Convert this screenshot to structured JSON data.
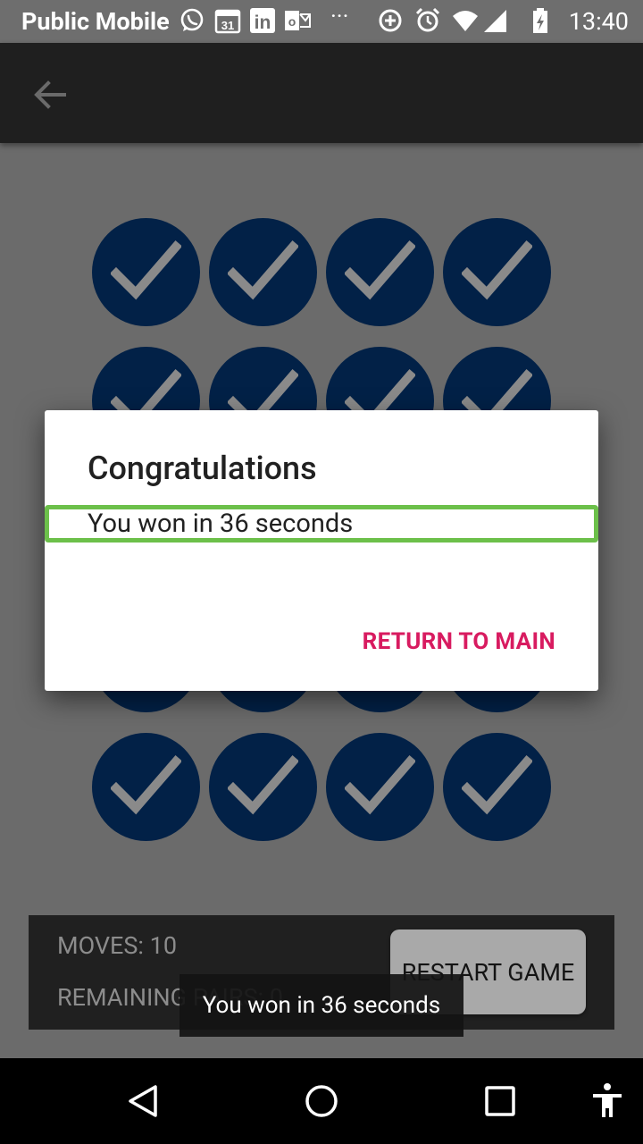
{
  "status_bar": {
    "carrier": "Public Mobile",
    "time": "13:40",
    "icons": [
      "whatsapp-icon",
      "calendar-icon",
      "linkedin-icon",
      "outlook-icon",
      "more-icon",
      "data-saver-icon",
      "alarm-icon",
      "wifi-icon",
      "signal-icon",
      "battery-charging-icon"
    ],
    "calendar_day": "31",
    "linkedin_text": "in",
    "outlook_text": "o",
    "more_text": "···"
  },
  "app_bar": {
    "back_icon": "arrow-back-icon"
  },
  "game": {
    "tile_state": "matched",
    "tile_icon": "check-icon",
    "tile_color": "#022147",
    "check_color": "#8a8a8a"
  },
  "stats": {
    "moves_label": "MOVES: 10",
    "remaining_label": "REMAINING PAIRS: 0"
  },
  "restart_button": {
    "label": "RESTART GAME"
  },
  "dialog": {
    "title": "Congratulations",
    "message": "You won in 36 seconds",
    "button": "RETURN TO MAIN",
    "accent": "#d81b60"
  },
  "toast": {
    "text": "You won in 36 seconds"
  },
  "nav_bar": {
    "icons": [
      "back-icon",
      "home-icon",
      "recents-icon",
      "accessibility-icon"
    ]
  }
}
